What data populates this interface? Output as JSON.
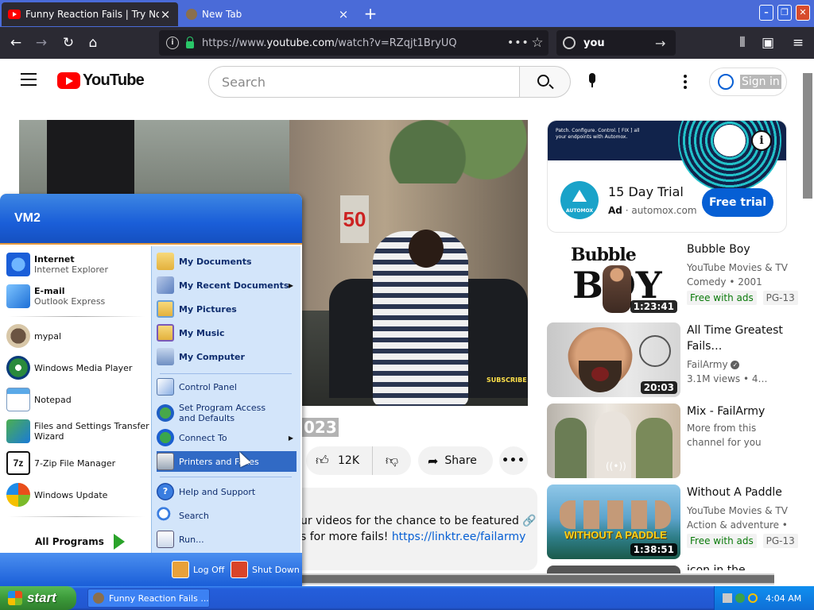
{
  "browser": {
    "tabs": [
      {
        "title": "Funny Reaction Fails | Try Not To L",
        "active": true
      },
      {
        "title": "New Tab",
        "active": false
      }
    ],
    "url_prefix": "https://www.",
    "url_domain": "youtube.com",
    "url_path": "/watch?v=RZqjt1BryUQ",
    "search_value": "you",
    "icons": [
      "back-icon",
      "forward-icon",
      "reload-icon",
      "home-icon",
      "library-icon",
      "sidebar-icon",
      "hamburger-icon"
    ]
  },
  "youtube": {
    "logo_text": "YouTube",
    "search_placeholder": "Search",
    "signin_label": "Sign in",
    "video_title_tail": "023",
    "likes": "12K",
    "share_label": "Share",
    "desc_line1": "ur videos for the chance to be featured 🔗",
    "desc_line2_prefix": "s for more fails! ",
    "desc_link": "https://linktr.ee/failarmy",
    "video_overlay_sign": "50",
    "video_overlay_subscribe": "SUBSCRIBE",
    "ad": {
      "banner_text": "Patch. Configure. Control. [ FIX ] all your endpoints with Automox.",
      "logo_text": "AUTOMOX",
      "title": "15 Day Trial",
      "ad_label": "Ad",
      "domain": "automox.com",
      "cta": "Free trial"
    },
    "recommendations": [
      {
        "title": "Bubble Boy",
        "meta1": "YouTube Movies & TV",
        "meta2": "Comedy • 2001",
        "badge1": "Free with ads",
        "badge2": "PG-13",
        "duration": "1:23:41",
        "thumb_text_a": "Bubble",
        "thumb_text_b": "BOY"
      },
      {
        "title": "All Time Greatest Fails…",
        "meta1": "FailArmy",
        "meta2": "3.1M views  • 4…",
        "duration": "20:03"
      },
      {
        "title": "Mix - FailArmy",
        "meta1": "More from this",
        "meta2": "channel for you",
        "live_icon": "((•))"
      },
      {
        "title": "Without A Paddle",
        "meta1": "YouTube Movies & TV",
        "meta2": "Action & adventure •",
        "badge1": "Free with ads",
        "badge2": "PG-13",
        "duration": "1:38:51",
        "thumb_text_a": "WITHOUT A PADDLE"
      },
      {
        "title": "icon in the..."
      }
    ]
  },
  "startmenu": {
    "user": "VM2",
    "pinned": [
      {
        "title": "Internet",
        "subtitle": "Internet Explorer",
        "icon": "ie-icon"
      },
      {
        "title": "E-mail",
        "subtitle": "Outlook Express",
        "icon": "mail-icon"
      }
    ],
    "recent": [
      {
        "label": "mypal",
        "icon": "mypal-icon"
      },
      {
        "label": "Windows Media Player",
        "icon": "media-player-icon"
      },
      {
        "label": "Notepad",
        "icon": "notepad-icon"
      },
      {
        "label": "Files and Settings Transfer Wizard",
        "icon": "transfer-wizard-icon"
      },
      {
        "label": "7-Zip File Manager",
        "icon": "7zip-icon",
        "icon_text": "7z"
      },
      {
        "label": "Windows Update",
        "icon": "windows-update-icon"
      }
    ],
    "all_programs": "All Programs",
    "right": [
      {
        "label": "My Documents",
        "bold": true
      },
      {
        "label": "My Recent Documents",
        "bold": true,
        "submenu": true
      },
      {
        "label": "My Pictures",
        "bold": true
      },
      {
        "label": "My Music",
        "bold": true
      },
      {
        "label": "My Computer",
        "bold": true
      },
      {
        "label": "Control Panel"
      },
      {
        "label": "Set Program Access and Defaults"
      },
      {
        "label": "Connect To",
        "submenu": true
      },
      {
        "label": "Printers and Faxes",
        "highlighted": true
      },
      {
        "label": "Help and Support",
        "icon_text": "?"
      },
      {
        "label": "Search"
      },
      {
        "label": "Run..."
      }
    ],
    "logoff": "Log Off",
    "shutdown": "Shut Down"
  },
  "taskbar": {
    "start_label": "start",
    "task_title": "Funny Reaction Fails ...",
    "clock": "4:04 AM"
  },
  "colors": {
    "yt_blue": "#065fd4",
    "xp_blue": "#245edb",
    "xp_green": "#3c9a3a",
    "firefox_dark": "#2b2a33",
    "highlight": "#316ac5"
  }
}
